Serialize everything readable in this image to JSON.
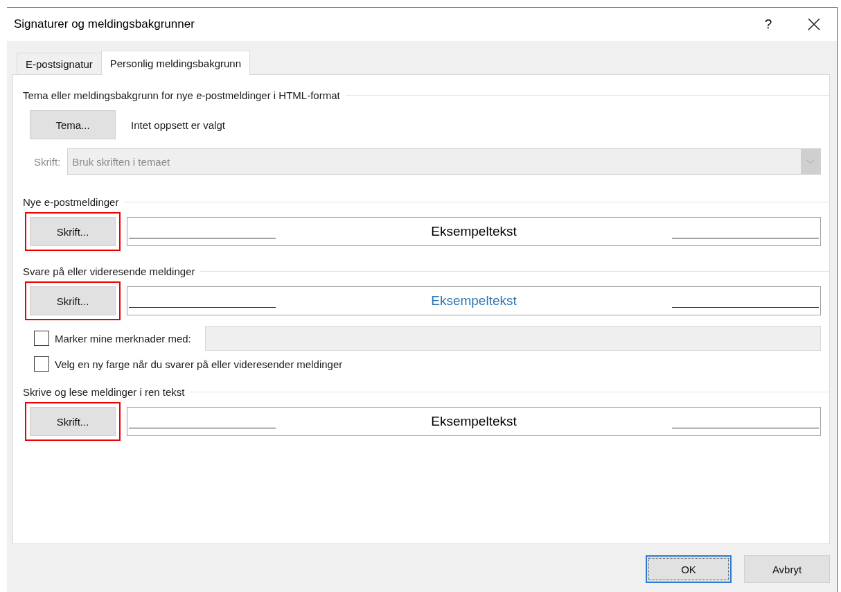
{
  "window": {
    "title": "Signaturer og meldingsbakgrunner",
    "help": "?"
  },
  "tabs": [
    {
      "label": "E-postsignatur",
      "selected": false
    },
    {
      "label": "Personlig meldingsbakgrunn",
      "selected": true
    }
  ],
  "sections": [
    {
      "kind": "theme",
      "heading": "Tema eller meldingsbakgrunn for nye e-postmeldinger i HTML-format",
      "button": {
        "label": "Tema...",
        "highlighted": false
      },
      "status": "Intet oppsett er valgt",
      "font_label": "Skrift:",
      "font_value": "Bruk skriften i temaet",
      "disabled": true
    },
    {
      "kind": "font",
      "heading": "Nye e-postmeldinger",
      "button": {
        "label": "Skrift...",
        "highlighted": true
      },
      "sample": {
        "text": "Eksempeltekst",
        "color": "#000000"
      }
    },
    {
      "kind": "font",
      "heading": "Svare på eller videresende meldinger",
      "button": {
        "label": "Skrift...",
        "highlighted": true
      },
      "sample": {
        "text": "Eksempeltekst",
        "color": "#2e75b6"
      },
      "options": [
        {
          "kind": "checkbox_field",
          "label": "Marker mine merknader med:",
          "checked": false
        },
        {
          "kind": "checkbox",
          "label": "Velg en ny farge når du svarer på eller videresender meldinger",
          "checked": false
        }
      ]
    },
    {
      "kind": "font",
      "heading": "Skrive og lese meldinger i ren tekst",
      "button": {
        "label": "Skrift...",
        "highlighted": true
      },
      "sample": {
        "text": "Eksempeltekst",
        "color": "#000000"
      }
    }
  ],
  "buttons": [
    {
      "label": "OK",
      "default": true
    },
    {
      "label": "Avbryt",
      "default": false
    }
  ]
}
